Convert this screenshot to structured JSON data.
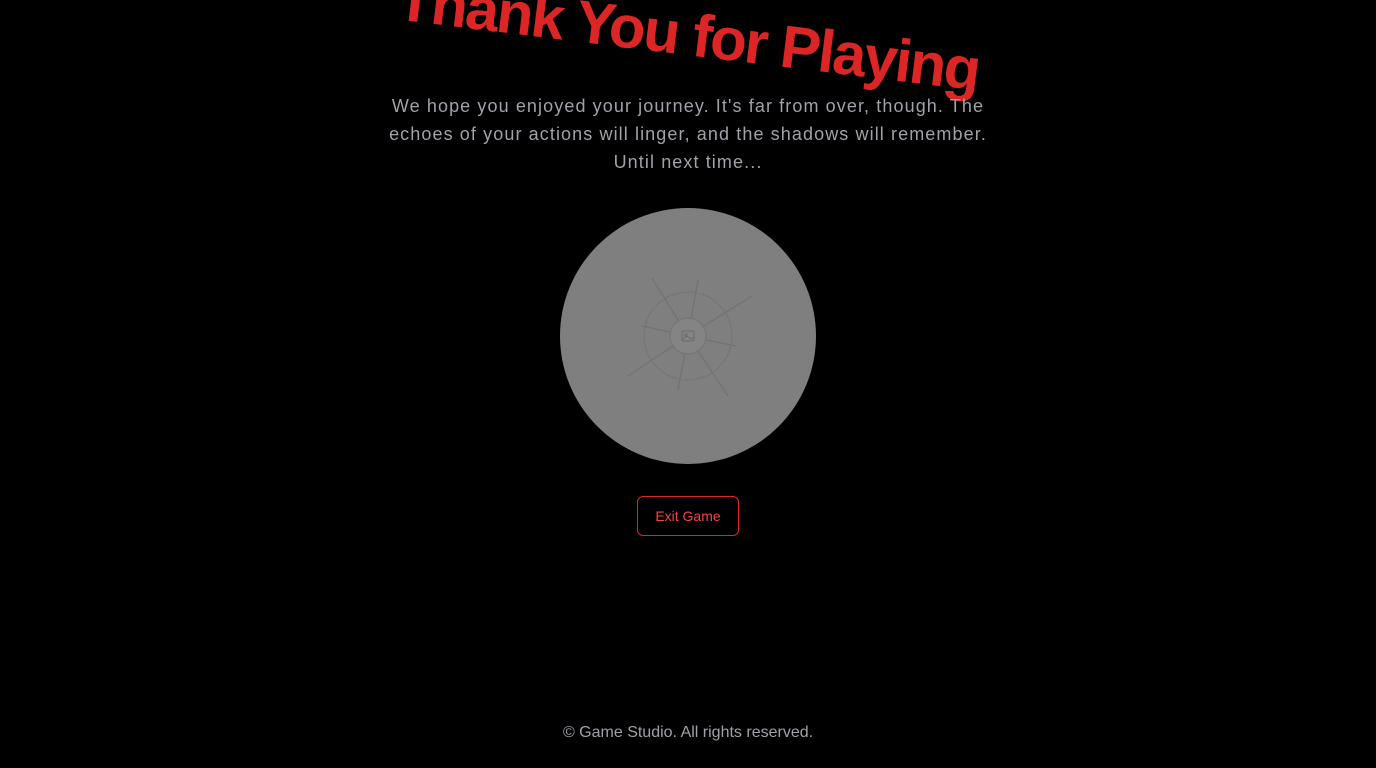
{
  "end_screen": {
    "title": "Thank You for Playing",
    "message": "We hope you enjoyed your journey. It's far from over, though. The echoes of your actions will linger, and the shadows will remember. Until next time...",
    "image_placeholder_icon": "broken-image-icon",
    "exit_label": "Exit Game"
  },
  "footer": {
    "copyright": "© Game Studio. All rights reserved."
  },
  "colors": {
    "background": "#000000",
    "accent_red": "#dc2626",
    "muted_text": "#a1a1aa",
    "placeholder_gray": "#7f7f7f"
  }
}
